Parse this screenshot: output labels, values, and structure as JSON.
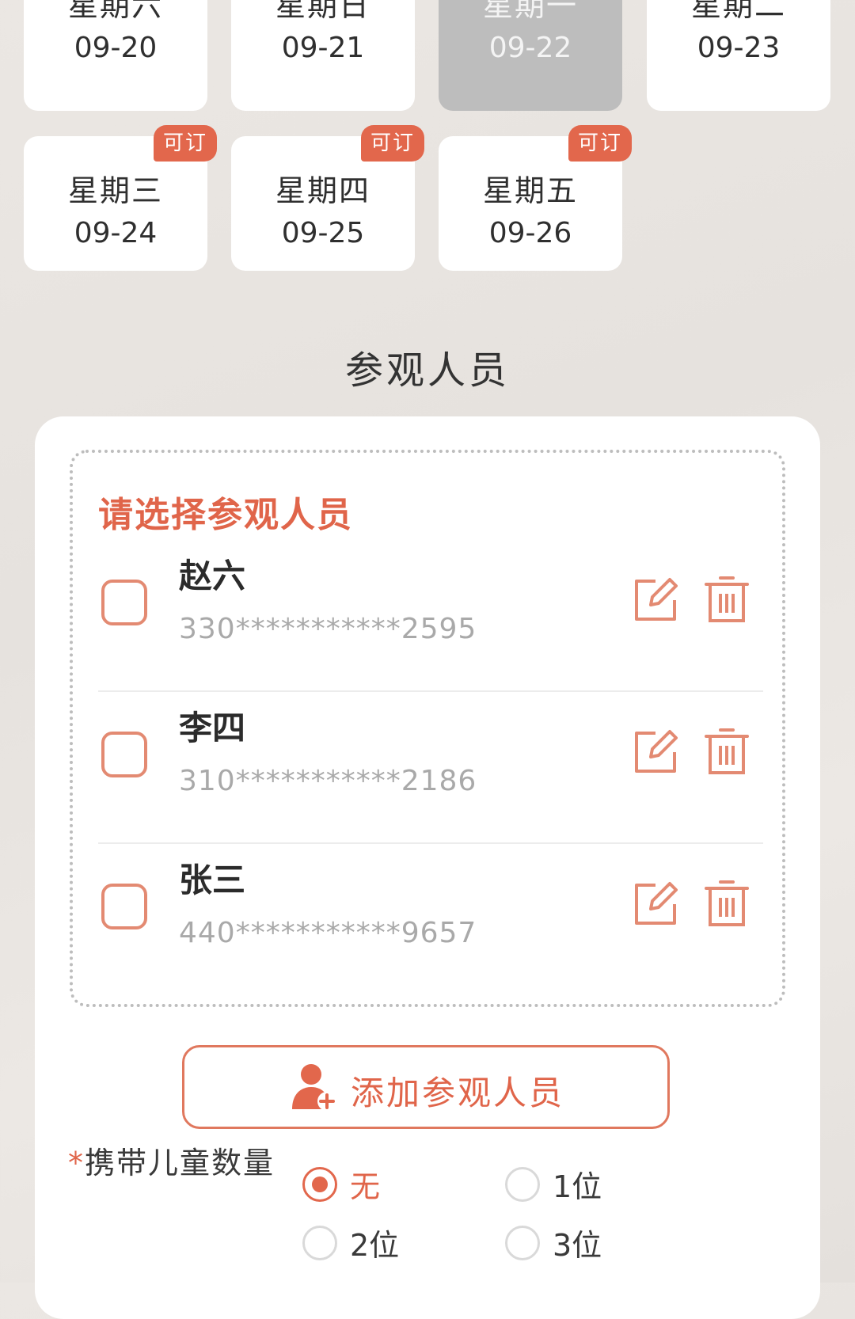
{
  "dates": [
    {
      "weekday": "星期六",
      "date": "09-20",
      "badge": "",
      "selected": false
    },
    {
      "weekday": "星期日",
      "date": "09-21",
      "badge": "",
      "selected": false
    },
    {
      "weekday": "星期一",
      "date": "09-22",
      "badge": "",
      "selected": true
    },
    {
      "weekday": "星期二",
      "date": "09-23",
      "badge": "",
      "selected": false
    },
    {
      "weekday": "星期三",
      "date": "09-24",
      "badge": "可订",
      "selected": false
    },
    {
      "weekday": "星期四",
      "date": "09-25",
      "badge": "可订",
      "selected": false
    },
    {
      "weekday": "星期五",
      "date": "09-26",
      "badge": "可订",
      "selected": false
    }
  ],
  "visitors_section": {
    "title": "参观人员",
    "box_title": "请选择参观人员",
    "visitors": [
      {
        "name": "赵六",
        "id_number": "330***********2595",
        "checked": false
      },
      {
        "name": "李四",
        "id_number": "310***********2186",
        "checked": false
      },
      {
        "name": "张三",
        "id_number": "440***********9657",
        "checked": false
      }
    ],
    "add_button_label": "添加参观人员"
  },
  "children": {
    "required_mark": "*",
    "label": "携带儿童数量",
    "options": [
      "无",
      "1位",
      "2位",
      "3位"
    ],
    "selected": "无"
  },
  "colors": {
    "accent": "#e2674c",
    "selected_date_bg": "#bdbdbd",
    "checkbox_border": "#e38a72"
  },
  "icons": {
    "edit": "edit-icon",
    "delete": "trash-icon",
    "add_person": "add-person-icon"
  }
}
